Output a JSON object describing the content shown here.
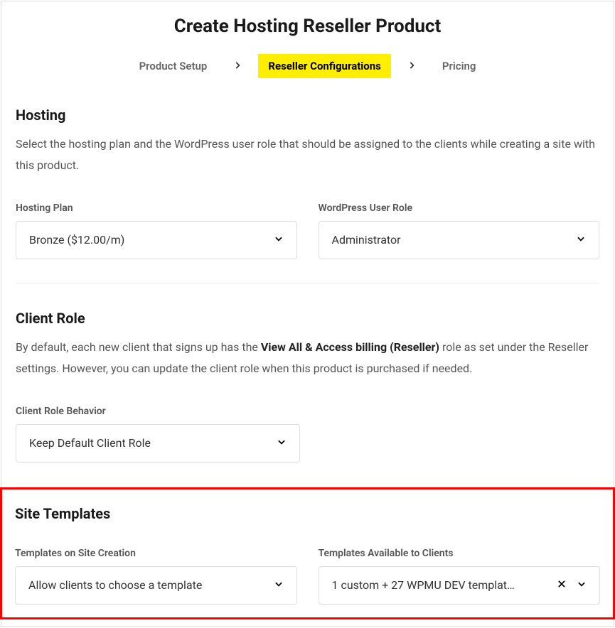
{
  "title": "Create Hosting Reseller Product",
  "steps": {
    "setup": "Product Setup",
    "config": "Reseller Configurations",
    "pricing": "Pricing"
  },
  "hosting": {
    "title": "Hosting",
    "desc": "Select the hosting plan and the WordPress user role that should be assigned to the clients while creating a site with this product.",
    "plan_label": "Hosting Plan",
    "plan_value": "Bronze ($12.00/m)",
    "role_label": "WordPress User Role",
    "role_value": "Administrator"
  },
  "client_role": {
    "title": "Client Role",
    "desc_pre": "By default, each new client that signs up has the ",
    "desc_bold": "View All & Access billing (Reseller)",
    "desc_post": " role as set under the Reseller settings. However, you can update the client role when this product is purchased if needed.",
    "behavior_label": "Client Role Behavior",
    "behavior_value": "Keep Default Client Role"
  },
  "site_templates": {
    "title": "Site Templates",
    "creation_label": "Templates on Site Creation",
    "creation_value": "Allow clients to choose a template",
    "available_label": "Templates Available to Clients",
    "available_value": "1 custom + 27 WPMU DEV templat…"
  }
}
